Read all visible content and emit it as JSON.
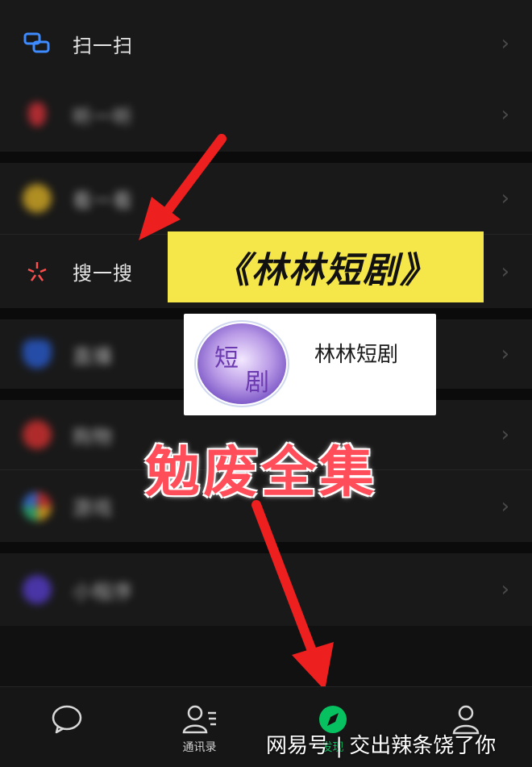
{
  "menu": {
    "items": [
      {
        "label": "扫一扫",
        "icon": "scan-icon",
        "blurred": false
      },
      {
        "label": "听一听",
        "icon": "music-icon",
        "blurred": true
      },
      {
        "label": "看一看",
        "icon": "look-icon",
        "blurred": true
      },
      {
        "label": "搜一搜",
        "icon": "search-spark-icon",
        "blurred": false
      },
      {
        "label": "直播",
        "icon": "live-icon",
        "blurred": true
      },
      {
        "label": "购物",
        "icon": "shop-icon",
        "blurred": true
      },
      {
        "label": "游戏",
        "icon": "game-icon",
        "blurred": true
      },
      {
        "label": "小程序",
        "icon": "mini-program-icon",
        "blurred": true
      }
    ],
    "chevron": "›"
  },
  "overlay": {
    "banner_text": "《林林短剧》",
    "card_title": "林林短剧",
    "card_logo_text_top": "短",
    "card_logo_text_bottom": "剧",
    "big_text": "勉废全集"
  },
  "tabbar": {
    "tabs": [
      {
        "label": "",
        "icon": "chat-bubble-icon"
      },
      {
        "label": "通讯录",
        "icon": "contacts-icon"
      },
      {
        "label": "发现",
        "icon": "compass-icon",
        "active": true
      },
      {
        "label": "",
        "icon": "me-icon"
      }
    ]
  },
  "watermark": "网易号 | 交出辣条饶了你",
  "colors": {
    "accent_green": "#07c160",
    "banner_yellow": "#f5e64a",
    "big_text_red": "#ff4d5a",
    "arrow_red": "#ee1f1f"
  }
}
